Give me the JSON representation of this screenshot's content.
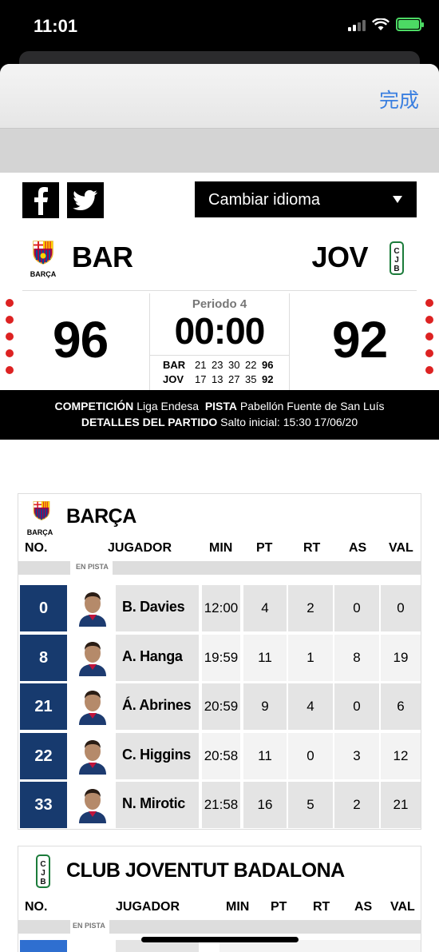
{
  "status": {
    "time": "11:01"
  },
  "nav": {
    "done": "完成"
  },
  "language_select": {
    "label": "Cambiar idioma"
  },
  "match": {
    "home": {
      "code": "BAR",
      "logo_text": "BARÇA",
      "score": "96"
    },
    "away": {
      "code": "JOV",
      "logo_text": "CJB",
      "score": "92"
    },
    "period": "Periodo 4",
    "clock": "00:00",
    "quarters": [
      {
        "team": "BAR",
        "q": [
          "21",
          "23",
          "30",
          "22"
        ],
        "total": "96"
      },
      {
        "team": "JOV",
        "q": [
          "17",
          "13",
          "27",
          "35"
        ],
        "total": "92"
      }
    ]
  },
  "info": {
    "competicion_label": "COMPETICIÓN",
    "competicion_value": "Liga Endesa",
    "pista_label": "PISTA",
    "pista_value": "Pabellón Fuente de San Luís",
    "detalles_label": "DETALLES DEL PARTIDO",
    "detalles_value": "Salto inicial: 15:30 17/06/20"
  },
  "columns": {
    "no": "NO.",
    "jugador": "JUGADOR",
    "min": "MIN",
    "pt": "PT",
    "rt": "RT",
    "as": "AS",
    "val": "VAL",
    "en_pista": "EN PISTA"
  },
  "team1": {
    "name": "BARÇA",
    "logo_text": "BARÇA",
    "players": [
      {
        "no": "0",
        "name": "B. Davies",
        "min": "12:00",
        "pt": "4",
        "rt": "2",
        "as": "0",
        "val": "0"
      },
      {
        "no": "8",
        "name": "A. Hanga",
        "min": "19:59",
        "pt": "11",
        "rt": "1",
        "as": "8",
        "val": "19"
      },
      {
        "no": "21",
        "name": "Á. Abrines",
        "min": "20:59",
        "pt": "9",
        "rt": "4",
        "as": "0",
        "val": "6"
      },
      {
        "no": "22",
        "name": "C. Higgins",
        "min": "20:58",
        "pt": "11",
        "rt": "0",
        "as": "3",
        "val": "12"
      },
      {
        "no": "33",
        "name": "N. Mirotic",
        "min": "21:58",
        "pt": "16",
        "rt": "5",
        "as": "2",
        "val": "21"
      }
    ]
  },
  "team2": {
    "name": "CLUB JOVENTUT BADALONA",
    "logo_text": "CJB"
  },
  "colors": {
    "accent": "#3a7fe0",
    "number_bg": "#173a6e",
    "dot_red": "#dd2222"
  }
}
